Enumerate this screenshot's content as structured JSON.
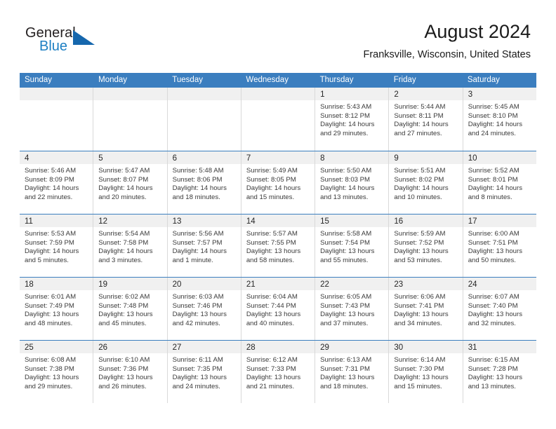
{
  "brand": {
    "name_part1": "General",
    "name_part2": "Blue",
    "flag_icon": "triangle-flag-icon"
  },
  "header": {
    "month_title": "August 2024",
    "location": "Franksville, Wisconsin, United States"
  },
  "calendar": {
    "weekdays": [
      "Sunday",
      "Monday",
      "Tuesday",
      "Wednesday",
      "Thursday",
      "Friday",
      "Saturday"
    ],
    "header_bg_color": "#3b7ebf",
    "day_band_color": "#f0f0f0",
    "weeks": [
      [
        {
          "day": "",
          "sunrise": "",
          "sunset": "",
          "daylight": "",
          "empty": true
        },
        {
          "day": "",
          "sunrise": "",
          "sunset": "",
          "daylight": "",
          "empty": true
        },
        {
          "day": "",
          "sunrise": "",
          "sunset": "",
          "daylight": "",
          "empty": true
        },
        {
          "day": "",
          "sunrise": "",
          "sunset": "",
          "daylight": "",
          "empty": true
        },
        {
          "day": "1",
          "sunrise": "Sunrise: 5:43 AM",
          "sunset": "Sunset: 8:12 PM",
          "daylight": "Daylight: 14 hours and 29 minutes."
        },
        {
          "day": "2",
          "sunrise": "Sunrise: 5:44 AM",
          "sunset": "Sunset: 8:11 PM",
          "daylight": "Daylight: 14 hours and 27 minutes."
        },
        {
          "day": "3",
          "sunrise": "Sunrise: 5:45 AM",
          "sunset": "Sunset: 8:10 PM",
          "daylight": "Daylight: 14 hours and 24 minutes."
        }
      ],
      [
        {
          "day": "4",
          "sunrise": "Sunrise: 5:46 AM",
          "sunset": "Sunset: 8:09 PM",
          "daylight": "Daylight: 14 hours and 22 minutes."
        },
        {
          "day": "5",
          "sunrise": "Sunrise: 5:47 AM",
          "sunset": "Sunset: 8:07 PM",
          "daylight": "Daylight: 14 hours and 20 minutes."
        },
        {
          "day": "6",
          "sunrise": "Sunrise: 5:48 AM",
          "sunset": "Sunset: 8:06 PM",
          "daylight": "Daylight: 14 hours and 18 minutes."
        },
        {
          "day": "7",
          "sunrise": "Sunrise: 5:49 AM",
          "sunset": "Sunset: 8:05 PM",
          "daylight": "Daylight: 14 hours and 15 minutes."
        },
        {
          "day": "8",
          "sunrise": "Sunrise: 5:50 AM",
          "sunset": "Sunset: 8:03 PM",
          "daylight": "Daylight: 14 hours and 13 minutes."
        },
        {
          "day": "9",
          "sunrise": "Sunrise: 5:51 AM",
          "sunset": "Sunset: 8:02 PM",
          "daylight": "Daylight: 14 hours and 10 minutes."
        },
        {
          "day": "10",
          "sunrise": "Sunrise: 5:52 AM",
          "sunset": "Sunset: 8:01 PM",
          "daylight": "Daylight: 14 hours and 8 minutes."
        }
      ],
      [
        {
          "day": "11",
          "sunrise": "Sunrise: 5:53 AM",
          "sunset": "Sunset: 7:59 PM",
          "daylight": "Daylight: 14 hours and 5 minutes."
        },
        {
          "day": "12",
          "sunrise": "Sunrise: 5:54 AM",
          "sunset": "Sunset: 7:58 PM",
          "daylight": "Daylight: 14 hours and 3 minutes."
        },
        {
          "day": "13",
          "sunrise": "Sunrise: 5:56 AM",
          "sunset": "Sunset: 7:57 PM",
          "daylight": "Daylight: 14 hours and 1 minute."
        },
        {
          "day": "14",
          "sunrise": "Sunrise: 5:57 AM",
          "sunset": "Sunset: 7:55 PM",
          "daylight": "Daylight: 13 hours and 58 minutes."
        },
        {
          "day": "15",
          "sunrise": "Sunrise: 5:58 AM",
          "sunset": "Sunset: 7:54 PM",
          "daylight": "Daylight: 13 hours and 55 minutes."
        },
        {
          "day": "16",
          "sunrise": "Sunrise: 5:59 AM",
          "sunset": "Sunset: 7:52 PM",
          "daylight": "Daylight: 13 hours and 53 minutes."
        },
        {
          "day": "17",
          "sunrise": "Sunrise: 6:00 AM",
          "sunset": "Sunset: 7:51 PM",
          "daylight": "Daylight: 13 hours and 50 minutes."
        }
      ],
      [
        {
          "day": "18",
          "sunrise": "Sunrise: 6:01 AM",
          "sunset": "Sunset: 7:49 PM",
          "daylight": "Daylight: 13 hours and 48 minutes."
        },
        {
          "day": "19",
          "sunrise": "Sunrise: 6:02 AM",
          "sunset": "Sunset: 7:48 PM",
          "daylight": "Daylight: 13 hours and 45 minutes."
        },
        {
          "day": "20",
          "sunrise": "Sunrise: 6:03 AM",
          "sunset": "Sunset: 7:46 PM",
          "daylight": "Daylight: 13 hours and 42 minutes."
        },
        {
          "day": "21",
          "sunrise": "Sunrise: 6:04 AM",
          "sunset": "Sunset: 7:44 PM",
          "daylight": "Daylight: 13 hours and 40 minutes."
        },
        {
          "day": "22",
          "sunrise": "Sunrise: 6:05 AM",
          "sunset": "Sunset: 7:43 PM",
          "daylight": "Daylight: 13 hours and 37 minutes."
        },
        {
          "day": "23",
          "sunrise": "Sunrise: 6:06 AM",
          "sunset": "Sunset: 7:41 PM",
          "daylight": "Daylight: 13 hours and 34 minutes."
        },
        {
          "day": "24",
          "sunrise": "Sunrise: 6:07 AM",
          "sunset": "Sunset: 7:40 PM",
          "daylight": "Daylight: 13 hours and 32 minutes."
        }
      ],
      [
        {
          "day": "25",
          "sunrise": "Sunrise: 6:08 AM",
          "sunset": "Sunset: 7:38 PM",
          "daylight": "Daylight: 13 hours and 29 minutes."
        },
        {
          "day": "26",
          "sunrise": "Sunrise: 6:10 AM",
          "sunset": "Sunset: 7:36 PM",
          "daylight": "Daylight: 13 hours and 26 minutes."
        },
        {
          "day": "27",
          "sunrise": "Sunrise: 6:11 AM",
          "sunset": "Sunset: 7:35 PM",
          "daylight": "Daylight: 13 hours and 24 minutes."
        },
        {
          "day": "28",
          "sunrise": "Sunrise: 6:12 AM",
          "sunset": "Sunset: 7:33 PM",
          "daylight": "Daylight: 13 hours and 21 minutes."
        },
        {
          "day": "29",
          "sunrise": "Sunrise: 6:13 AM",
          "sunset": "Sunset: 7:31 PM",
          "daylight": "Daylight: 13 hours and 18 minutes."
        },
        {
          "day": "30",
          "sunrise": "Sunrise: 6:14 AM",
          "sunset": "Sunset: 7:30 PM",
          "daylight": "Daylight: 13 hours and 15 minutes."
        },
        {
          "day": "31",
          "sunrise": "Sunrise: 6:15 AM",
          "sunset": "Sunset: 7:28 PM",
          "daylight": "Daylight: 13 hours and 13 minutes."
        }
      ]
    ]
  }
}
